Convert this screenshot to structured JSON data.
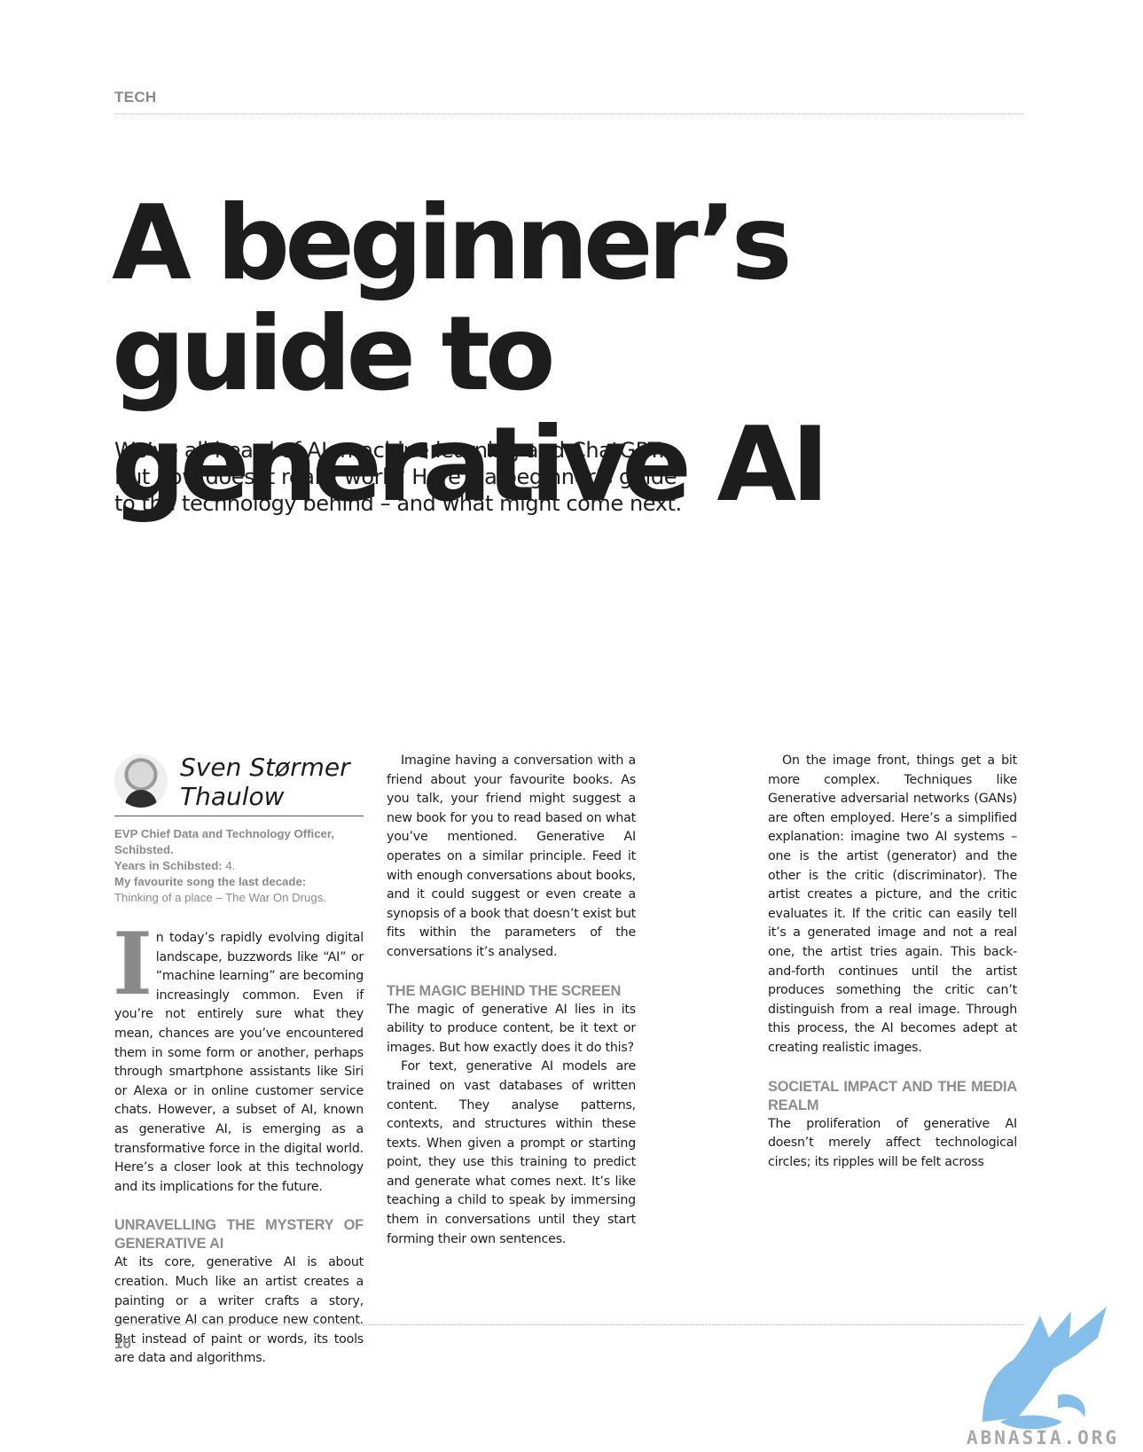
{
  "header": {
    "section": "TECH"
  },
  "article": {
    "headline": "A beginner’s guide to generative AI",
    "intro": "We’ve all heard of AI, machine learning and ChatGPT. But how does it really work? Here’s a beginner’s guide to the technology behind – and what might come next."
  },
  "author": {
    "name": "Sven Størmer Thaulow",
    "title": "EVP Chief Data and Technology Officer, Schibsted.",
    "years_label": "Years in Schibsted:",
    "years_value": "4.",
    "song_label": "My favourite song the last decade:",
    "song_value": "Thinking of a place – The War On Drugs."
  },
  "body": {
    "dropcap": "I",
    "p1": "n today’s rapidly evolving digital landscape, buzzwords like “AI” or “machine learning” are becoming increasingly common. Even if you’re not entirely sure what they mean, chances are you’ve encountered them in some form or another, perhaps through smartphone assistants like Siri or Alexa or in online customer service chats. However, a subset of AI, known as generative AI, is emerging as a transformative force in the digital world. Here’s a closer look at this technology and its implications for the future.",
    "h1": "UNRAVELLING THE MYSTERY OF GENERATIVE AI",
    "p2": "At its core, generative AI is about creation. Much like an artist creates a painting or a writer crafts a story, generative AI can produce new content. But instead of paint or words, its tools are data and algorithms.",
    "p3": "Imagine having a conversation with a friend about your favourite books. As you talk, your friend might suggest a new book for you to read based on what you’ve mentioned. Generative AI operates on a similar principle. Feed it with enough conversations about books, and it could suggest or even create a synopsis of a book that doesn’t exist but fits within the parameters of the conversations it’s analysed.",
    "h2": "THE MAGIC BEHIND THE SCREEN",
    "p4": "The magic of generative AI lies in its ability to produce content, be it text or images. But how exactly does it do this?",
    "p5": "For text, generative AI models are trained on vast databases of written content. They analyse patterns, contexts, and structures within these texts. When given a prompt or starting point, they use this training to predict and generate what comes next. It’s like teaching a child to speak by immersing them in conversations until they start forming their own sentences.",
    "p6": "On the image front, things get a bit more complex. Techniques like Generative adversarial networks (GANs) are often employed. Here’s a simplified explanation: imagine two AI systems – one is the artist (generator) and the other is the critic (discriminator). The artist creates a picture, and the critic evaluates it. If the critic can easily tell it’s a generated image and not a real one, the artist tries again. This back-and-forth continues until the artist produces something the critic can’t distinguish from a real image. Through this process, the AI becomes adept at creating realistic images.",
    "h3": "SOCIETAL IMPACT AND THE MEDIA REALM",
    "p7": "The proliferation of generative AI doesn’t merely affect technological circles; its ripples will be felt across"
  },
  "footer": {
    "page_number": "10"
  },
  "watermark": {
    "text": "ABNASIA.ORG",
    "icon": "griffin-logo",
    "color": "#6fb3e6"
  }
}
